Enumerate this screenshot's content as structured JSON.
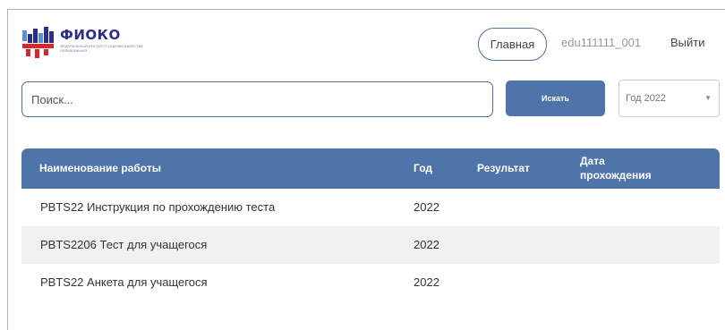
{
  "logo": {
    "title": "ФИОКО",
    "subtitle": "ФЕДЕРАЛЬНЫЙ ИНСТИТУТ ОЦЕНКИ КАЧЕСТВА ОБРАЗОВАНИЯ",
    "colors": {
      "blue": "#2a2f86",
      "red": "#d8262f",
      "light_blue": "#5a8fd0"
    }
  },
  "nav": {
    "home_label": "Главная",
    "user_label": "edu111111_001",
    "logout_label": "Выйти"
  },
  "search": {
    "placeholder": "Поиск...",
    "button_label": "Искать"
  },
  "year_filter": {
    "selected": "Год 2022"
  },
  "table": {
    "columns": {
      "name": "Наименование работы",
      "year": "Год",
      "result": "Результат",
      "date": "Дата прохождения"
    },
    "rows": [
      {
        "name": "PBTS22 Инструкция по прохождению теста",
        "year": "2022",
        "result": "",
        "date": ""
      },
      {
        "name": "PBTS2206 Тест для учащегося",
        "year": "2022",
        "result": "",
        "date": ""
      },
      {
        "name": "PBTS22 Анкета для учащегося",
        "year": "2022",
        "result": "",
        "date": ""
      }
    ]
  },
  "theme": {
    "accent": "#4e74aa",
    "row_alt": "#f1f1f1"
  }
}
